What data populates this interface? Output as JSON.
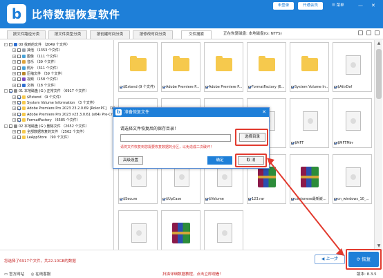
{
  "app": {
    "title": "比特数据恢复软件",
    "logo_letter": "b"
  },
  "titlebar": {
    "login_label": "未登录",
    "buy_label": "开通会员",
    "menu_label": "☰ 菜单",
    "min_icon": "—",
    "close_icon": "✕"
  },
  "tabs": [
    {
      "label": "按文件路径分类"
    },
    {
      "label": "按文件类型分类"
    },
    {
      "label": "按创建时间分类"
    },
    {
      "label": "按修改时间分类"
    },
    {
      "label": "文件搜索"
    }
  ],
  "status": {
    "path_text": "正在恢复磁盘: 本地磁盘(G: NTFS)"
  },
  "tree": [
    {
      "text": "00 找到的文件 （2049 个文件）",
      "checked": false,
      "icon_color": "#2f6fd0",
      "expander": "-"
    },
    {
      "text": "其他 （1353 个文件）",
      "checked": false,
      "icon_color": "#9aa3ad",
      "expander": "+"
    },
    {
      "text": "图像 （111 个文件）",
      "checked": false,
      "icon_color": "#4aa3d8",
      "expander": "+"
    },
    {
      "text": "音乐 （39 个文件）",
      "checked": false,
      "icon_color": "#e0a43a",
      "expander": "+"
    },
    {
      "text": "照片 （311 个文件）",
      "checked": false,
      "icon_color": "#4aa3d8",
      "expander": "+"
    },
    {
      "text": "压缩文件 （59 个文件）",
      "checked": false,
      "icon_color": "#b8862a",
      "expander": "+"
    },
    {
      "text": "视频 （158 个文件）",
      "checked": false,
      "icon_color": "#7d4bc2",
      "expander": "+"
    },
    {
      "text": "文档 （18 个文件）",
      "checked": false,
      "icon_color": "#2f6fd0",
      "expander": "+"
    },
    {
      "text": "01 本地磁盘 (G:) 正常文件 （6917 个文件）",
      "checked": true,
      "icon_color": "#8a8a8a",
      "expander": "-"
    },
    {
      "text": "$Extend （9 个文件）",
      "checked": true,
      "icon_color": "#f6c94d",
      "expander": "+"
    },
    {
      "text": "System Volume Information （3 个文件）",
      "checked": true,
      "icon_color": "#f6c94d",
      "expander": "+"
    },
    {
      "text": "Adobe Premiere Pro 2023 23.2.0.69 [RolonPC] （112 个文件）",
      "checked": true,
      "icon_color": "#f6c94d",
      "expander": "+"
    },
    {
      "text": "Adobe Premiere Pro 2023 v23.3.0.61 (x64) Pre-Cra... （...）",
      "checked": true,
      "icon_color": "#f6c94d",
      "expander": "+"
    },
    {
      "text": "FormatFactory （6585 个文件）",
      "checked": true,
      "icon_color": "#f6c94d",
      "expander": "+"
    },
    {
      "text": "02 本地磁盘 (G:) 删除文件 （2652 个文件）",
      "checked": false,
      "icon_color": "#8a8a8a",
      "expander": "-"
    },
    {
      "text": "全部数据恢复的文件 （2562 个文件）",
      "checked": false,
      "icon_color": "#f6c94d",
      "expander": "+"
    },
    {
      "text": "LeAppStore （90 个文件）",
      "checked": false,
      "icon_color": "#f6c94d",
      "expander": "+"
    }
  ],
  "tiles": [
    {
      "label": "$Extend (9 个文件)",
      "kind": "folder",
      "checked": true
    },
    {
      "label": "Adobe Premiere P...",
      "kind": "folder",
      "checked": true
    },
    {
      "label": "Adobe Premiere P...",
      "kind": "folder",
      "checked": true
    },
    {
      "label": "FormatFactory (6...",
      "kind": "folder",
      "checked": true
    },
    {
      "label": "System Volume In...",
      "kind": "folder",
      "checked": true
    },
    {
      "label": "$AttrDef",
      "kind": "doc",
      "checked": true
    },
    {
      "label": "",
      "kind": "doc",
      "checked": true
    },
    {
      "label": "",
      "kind": "doc",
      "checked": true
    },
    {
      "label": "",
      "kind": "doc",
      "checked": true
    },
    {
      "label": "",
      "kind": "doc",
      "checked": true
    },
    {
      "label": "$MFT",
      "kind": "doc",
      "checked": true
    },
    {
      "label": "$MFTMirr",
      "kind": "doc",
      "checked": true
    },
    {
      "label": "$Secure",
      "kind": "doc",
      "checked": true
    },
    {
      "label": "$UpCase",
      "kind": "doc",
      "checked": true
    },
    {
      "label": "$Volume",
      "kind": "doc",
      "checked": true
    },
    {
      "label": "123.rar",
      "kind": "rar",
      "checked": true
    },
    {
      "label": "cantonese最新嵌...",
      "kind": "rar",
      "checked": true
    },
    {
      "label": "cn_windows_10_...",
      "kind": "doc",
      "checked": true
    },
    {
      "label": "",
      "kind": "doc",
      "checked": true
    },
    {
      "label": "",
      "kind": "rar",
      "checked": true
    },
    {
      "label": "",
      "kind": "doc",
      "checked": true
    }
  ],
  "footer": {
    "selection_text": "您选择了6917个文件，共22.10GB的数据",
    "prev_label": "上一步",
    "recover_label": "恢复",
    "website_label": "官方网站",
    "service_label": "在线客服",
    "tip_text": "扫描详细数据教程，点击立即观看！",
    "version_text": "版本: 8.3.5"
  },
  "dialog": {
    "title": "准备恢复文件",
    "prompt": "请选择文件恢复后的保存目录！",
    "path_value": "",
    "browse_label": "选择目录",
    "warning": "请将文件恢复到您需要恢复数据的分区，以免造成二次破坏！",
    "advanced_label": "高级设置",
    "ok_label": "确定",
    "cancel_label": "取 消",
    "close_icon": "✕"
  },
  "colors": {
    "brand": "#1e7fd8",
    "highlight": "#e23a2e",
    "warning": "#d33"
  }
}
